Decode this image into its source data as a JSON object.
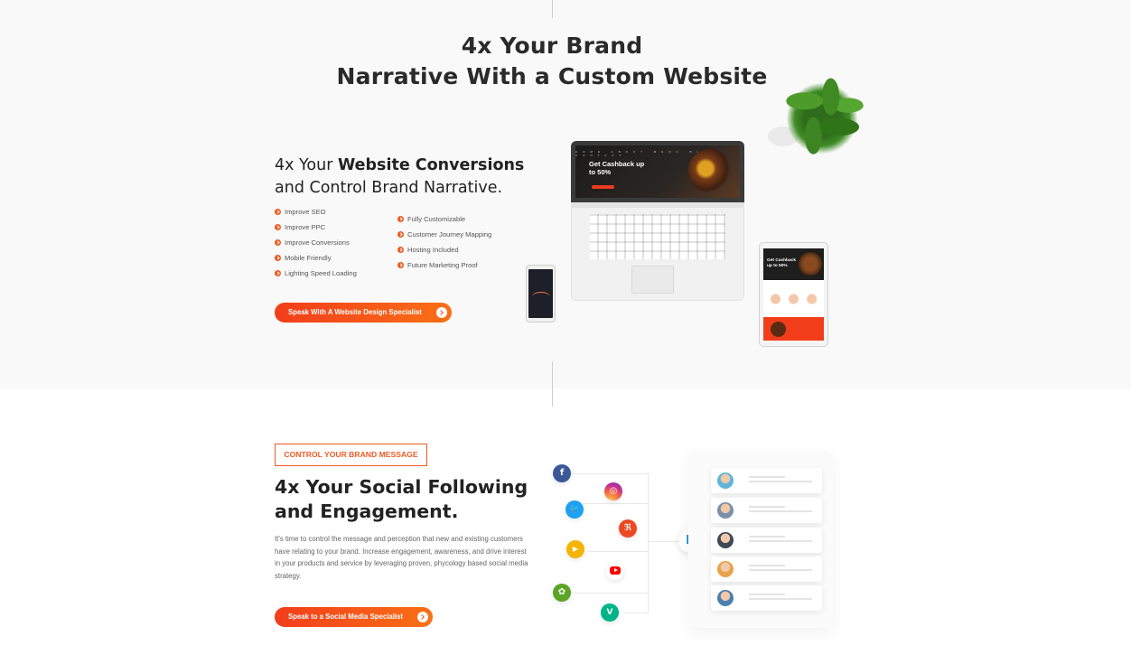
{
  "hero": {
    "title_line1": "4x Your Brand",
    "title_line2": "Narrative With a Custom Website"
  },
  "website": {
    "heading_pre": "4x Your ",
    "heading_bold": "Website Conversions",
    "heading_line2": "and Control Brand Narrative.",
    "features_left": [
      "Improve SEO",
      "Improve PPC",
      "Improve Conversions",
      "Mobile Friendly",
      "Lighting Speed Loading"
    ],
    "features_right": [
      "Fully Customizable",
      "Customer Journey Mapping",
      "Hosting Included",
      "Future Marketing Proof"
    ],
    "cta_label": "Speak With A Website Design Specialist",
    "laptop_promo": "Get Cashback up to 50%",
    "laptop_nav": "HOME ABOUT MENU BLOG CONTACT",
    "tablet_promo": "Get Cashback up to 50%"
  },
  "social": {
    "tag": "CONTROL YOUR BRAND MESSAGE",
    "title_line1": "4x Your Social Following",
    "title_line2": "and Engagement.",
    "description": "It's time to control the message and perception that new and existing customers have relating to your brand. Increase engagement, awareness, and drive interest in your products and service by leveraging proven, phycology based social media strategy.",
    "cta_label": "Speak to a Social Media Specialist",
    "hub_letter": "R",
    "icons": [
      {
        "name": "facebook-icon",
        "glyph": "f",
        "color": "#3b5998"
      },
      {
        "name": "instagram-icon",
        "glyph": "◎",
        "color": "#e1306c"
      },
      {
        "name": "twitter-icon",
        "glyph": "🐦",
        "color": "#1da1f2"
      },
      {
        "name": "stumbleupon-icon",
        "glyph": "ℜ",
        "color": "#eb4924"
      },
      {
        "name": "video-play-icon",
        "glyph": "▶",
        "color": "#f4b400"
      },
      {
        "name": "youtube-icon",
        "glyph": "",
        "color": "#ff0000"
      },
      {
        "name": "evernote-icon",
        "glyph": "✿",
        "color": "#5ba525"
      },
      {
        "name": "vine-icon",
        "glyph": "V",
        "color": "#00b488"
      }
    ],
    "avatar_colors": [
      "#5fb6d8",
      "#7a8fa8",
      "#3d4a55",
      "#e8a24a",
      "#4b7fb0"
    ]
  },
  "colors": {
    "accent": "#f23d1b",
    "accent_end": "#f97016",
    "heading": "#222222"
  }
}
